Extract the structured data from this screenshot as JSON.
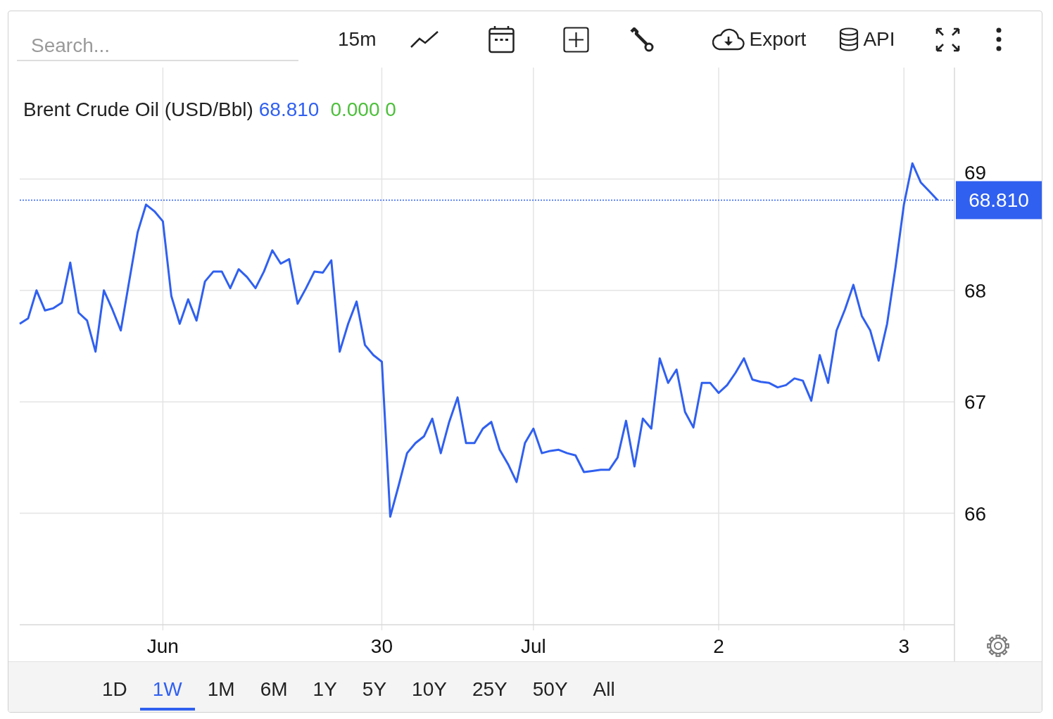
{
  "toolbar": {
    "search": {
      "placeholder": "Search..."
    },
    "interval": "15m",
    "export": "Export",
    "api": "API"
  },
  "chart": {
    "legend": {
      "value": "68.810",
      "change": "0.000 0"
    },
    "price_label": "68.810",
    "chart_data": {
      "type": "line",
      "grid": true,
      "ref_lines": [
        {
          "axis": "y",
          "value": 68.81,
          "color": "#3060f0"
        }
      ],
      "ylim": [
        65,
        70
      ],
      "yticks": [
        66,
        67,
        68,
        69
      ],
      "categories": [
        null,
        null,
        null,
        null,
        null,
        null,
        null,
        null,
        null,
        null,
        null,
        null,
        null,
        null,
        null,
        null,
        null,
        "Jun",
        null,
        null,
        null,
        null,
        null,
        null,
        null,
        null,
        null,
        null,
        null,
        null,
        null,
        null,
        null,
        null,
        null,
        null,
        null,
        null,
        null,
        null,
        null,
        null,
        null,
        "30",
        null,
        null,
        null,
        null,
        null,
        null,
        null,
        null,
        null,
        null,
        null,
        null,
        null,
        null,
        null,
        null,
        null,
        "Jul",
        null,
        null,
        null,
        null,
        null,
        null,
        null,
        null,
        null,
        null,
        null,
        null,
        null,
        null,
        null,
        null,
        null,
        null,
        null,
        null,
        null,
        "2",
        null,
        null,
        null,
        null,
        null,
        null,
        null,
        null,
        null,
        null,
        null,
        null,
        null,
        null,
        null,
        null,
        null,
        null,
        null,
        null,
        null,
        "3",
        null,
        null,
        null,
        null
      ],
      "series": [
        {
          "name": "Brent Crude Oil (USD/Bbl)",
          "color": "#3060f0",
          "values": [
            67.7,
            67.75,
            68.0,
            67.82,
            67.84,
            67.89,
            68.25,
            67.8,
            67.73,
            67.45,
            68.0,
            67.83,
            67.64,
            68.08,
            68.52,
            68.77,
            68.71,
            68.62,
            67.95,
            67.7,
            67.92,
            67.73,
            68.08,
            68.17,
            68.17,
            68.02,
            68.19,
            68.12,
            68.02,
            68.17,
            68.36,
            68.24,
            68.28,
            67.88,
            68.02,
            68.17,
            68.16,
            68.27,
            67.45,
            67.7,
            67.9,
            67.51,
            67.42,
            67.36,
            65.97,
            66.25,
            66.54,
            66.63,
            66.69,
            66.85,
            66.54,
            66.82,
            67.04,
            66.63,
            66.63,
            66.76,
            66.82,
            66.57,
            66.44,
            66.28,
            66.63,
            66.76,
            66.54,
            66.56,
            66.57,
            66.54,
            66.52,
            66.37,
            66.38,
            66.39,
            66.39,
            66.5,
            66.83,
            66.42,
            66.85,
            66.76,
            67.39,
            67.17,
            67.29,
            66.91,
            66.77,
            67.17,
            67.17,
            67.08,
            67.15,
            67.26,
            67.39,
            67.2,
            67.18,
            67.17,
            67.13,
            67.15,
            67.21,
            67.19,
            67.01,
            67.42,
            67.17,
            67.64,
            67.83,
            68.05,
            67.77,
            67.64,
            67.37,
            67.7,
            68.21,
            68.77,
            69.14,
            68.97,
            68.89,
            68.81
          ]
        }
      ]
    }
  },
  "ranges": [
    {
      "label": "1D",
      "selected": false
    },
    {
      "label": "1W",
      "selected": true
    },
    {
      "label": "1M",
      "selected": false
    },
    {
      "label": "6M",
      "selected": false
    },
    {
      "label": "1Y",
      "selected": false
    },
    {
      "label": "5Y",
      "selected": false
    },
    {
      "label": "10Y",
      "selected": false
    },
    {
      "label": "25Y",
      "selected": false
    },
    {
      "label": "50Y",
      "selected": false
    },
    {
      "label": "All",
      "selected": false
    }
  ]
}
